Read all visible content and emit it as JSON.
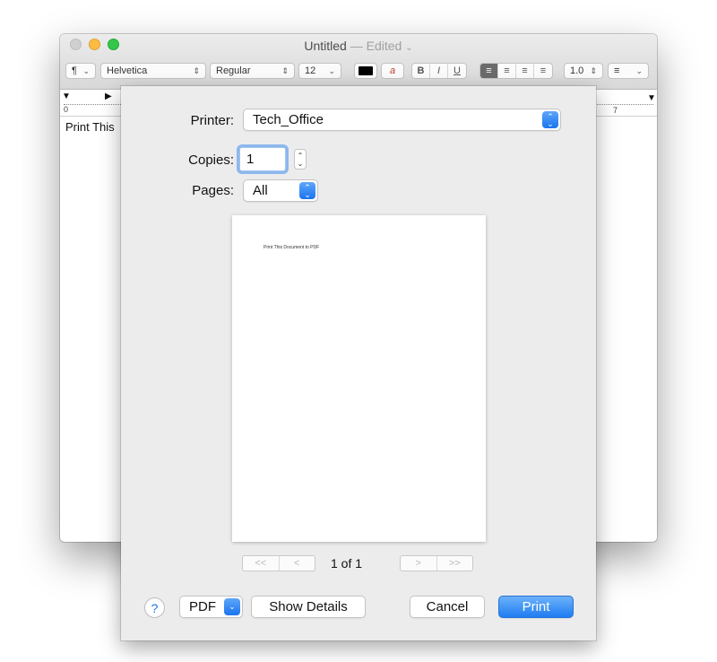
{
  "window": {
    "title": "Untitled",
    "title_separator": "—",
    "title_status": "Edited",
    "title_chevron": "⌄"
  },
  "toolbar": {
    "paragraph_style": "¶",
    "font_family": "Helvetica",
    "font_style": "Regular",
    "font_size": "12",
    "bold": "B",
    "italic": "I",
    "underline": "U",
    "line_spacing": "1.0",
    "list_icon": "≡",
    "text_color": "#000000",
    "highlight_icon": "a"
  },
  "ruler": {
    "tick_start": "0",
    "tick_end": "7"
  },
  "document": {
    "body_text": "Print This"
  },
  "print": {
    "printer_label": "Printer:",
    "printer_value": "Tech_Office",
    "copies_label": "Copies:",
    "copies_value": "1",
    "pages_label": "Pages:",
    "pages_value": "All",
    "preview_text": "Print This Document to PDF",
    "nav_first": "<<",
    "nav_prev": "<",
    "nav_next": ">",
    "nav_last": ">>",
    "page_count": "1 of 1",
    "help": "?",
    "pdf_label": "PDF",
    "show_details_label": "Show Details",
    "cancel_label": "Cancel",
    "print_label": "Print",
    "accent_color": "#1a74ee"
  }
}
